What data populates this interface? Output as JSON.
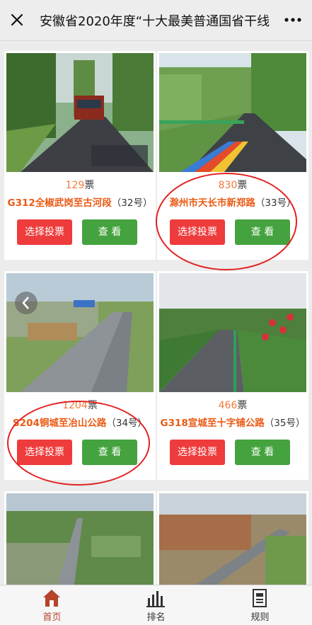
{
  "header": {
    "title": "安徽省2020年度“十大最美普通国省干线",
    "close_icon": "close-icon",
    "more_icon": "more-icon"
  },
  "cards": [
    {
      "votes": "129",
      "votes_suffix": "票",
      "road": "G312全椒武岗至古河段",
      "number": "（32号）",
      "vote_label": "选择投票",
      "view_label": "查 看"
    },
    {
      "votes": "830",
      "votes_suffix": "票",
      "road": "滁州市天长市新郑路",
      "number": "（33号）",
      "vote_label": "选择投票",
      "view_label": "查 看"
    },
    {
      "votes": "1204",
      "votes_suffix": "票",
      "road": "S204铜城至冶山公路",
      "number": "（34号）",
      "vote_label": "选择投票",
      "view_label": "查 看"
    },
    {
      "votes": "466",
      "votes_suffix": "票",
      "road": "G318宣城至十字铺公路",
      "number": "（35号）",
      "vote_label": "选择投票",
      "view_label": "查 看"
    }
  ],
  "bottom_nav": [
    {
      "label": "首页",
      "icon": "home-icon",
      "active": true
    },
    {
      "label": "排名",
      "icon": "bar-chart-icon",
      "active": false
    },
    {
      "label": "规则",
      "icon": "document-icon",
      "active": false
    }
  ],
  "colors": {
    "vote_button": "#ee3b3b",
    "view_button": "#45a33f",
    "vote_count": "#f3793a",
    "road_name": "#ea5a14",
    "highlight_ring": "#e22222",
    "active_nav": "#b4442b"
  }
}
